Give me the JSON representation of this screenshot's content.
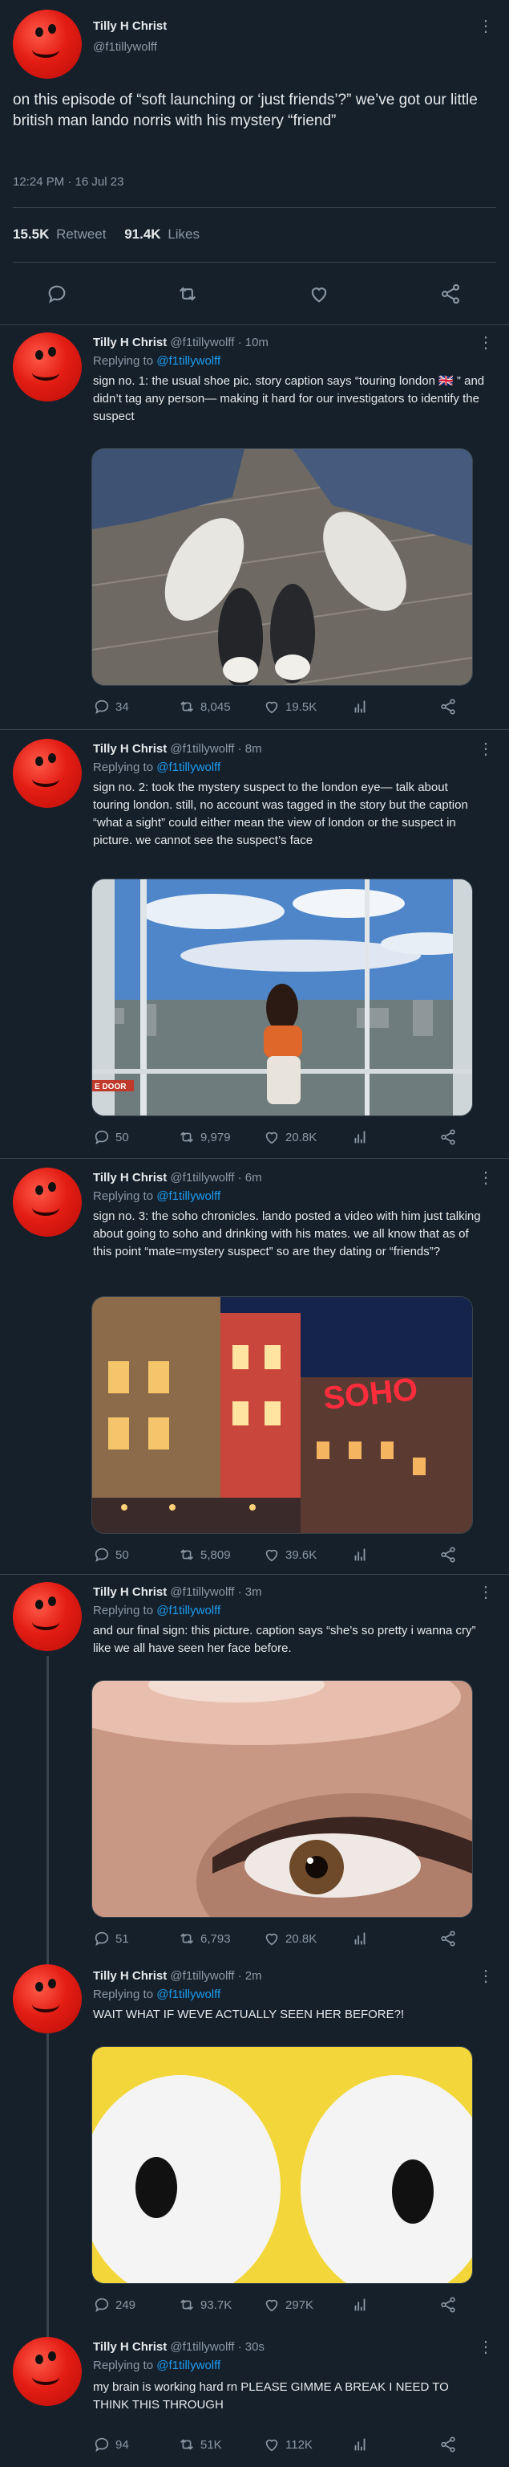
{
  "main": {
    "author": {
      "name": "Tilly H Christ",
      "handle": "@f1tillywolff"
    },
    "text": "on this episode of “soft launching or ‘just friends’?” we’ve got our little british man lando norris with his mystery “friend”",
    "timestamp": "12:24 PM · 16 Jul 23",
    "retweets": "15.5K",
    "retweets_label": "Retweet",
    "likes": "91.4K",
    "likes_label": "Likes"
  },
  "replying_to_label": "Replying to",
  "replying_to_handle": "@f1tillywolff",
  "replies": [
    {
      "name": "Tilly H Christ",
      "handle": "@f1tillywolff · 10m",
      "text": "sign no. 1: the usual shoe pic. story caption says “touring london 🇬🇧 ” and didn’t tag any person— making it hard for our investigators to identify the suspect",
      "replies": "34",
      "retweets": "8,045",
      "likes": "19.5K"
    },
    {
      "name": "Tilly H Christ",
      "handle": "@f1tillywolff · 8m",
      "text": "sign no. 2: took the mystery suspect to the london eye— talk about touring london. still, no account was tagged in the story but the caption “what a sight” could either mean the view of london or the suspect in picture. we cannot see the suspect’s face",
      "replies": "50",
      "retweets": "9,979",
      "likes": "20.8K",
      "image_text": "E DOOR"
    },
    {
      "name": "Tilly H Christ",
      "handle": "@f1tillywolff · 6m",
      "text": "sign no. 3: the soho chronicles. lando posted a video with him just talking about going to soho and drinking with his mates. we all know that as of this point “mate=mystery suspect” so are they dating or “friends”?",
      "replies": "50",
      "retweets": "5,809",
      "likes": "39.6K",
      "image_text": "SOHO"
    },
    {
      "name": "Tilly H Christ",
      "handle": "@f1tillywolff · 3m",
      "text": "and our final sign: this picture. caption says “she’s so pretty i wanna cry” like we all have seen her face before.",
      "replies": "51",
      "retweets": "6,793",
      "likes": "20.8K"
    },
    {
      "name": "Tilly H Christ",
      "handle": "@f1tillywolff · 2m",
      "text": "WAIT WHAT IF WEVE ACTUALLY SEEN HER BEFORE?!",
      "replies": "249",
      "retweets": "93.7K",
      "likes": "297K"
    },
    {
      "name": "Tilly H Christ",
      "handle": "@f1tillywolff · 30s",
      "text": "my brain is working hard rn PLEASE GIMME A BREAK I NEED TO THINK THIS THROUGH",
      "replies": "94",
      "retweets": "51K",
      "likes": "112K"
    }
  ],
  "colors": {
    "background": "#15202b",
    "accent": "#1d9bf0",
    "muted": "#8b98a5",
    "divider": "#38444d"
  }
}
